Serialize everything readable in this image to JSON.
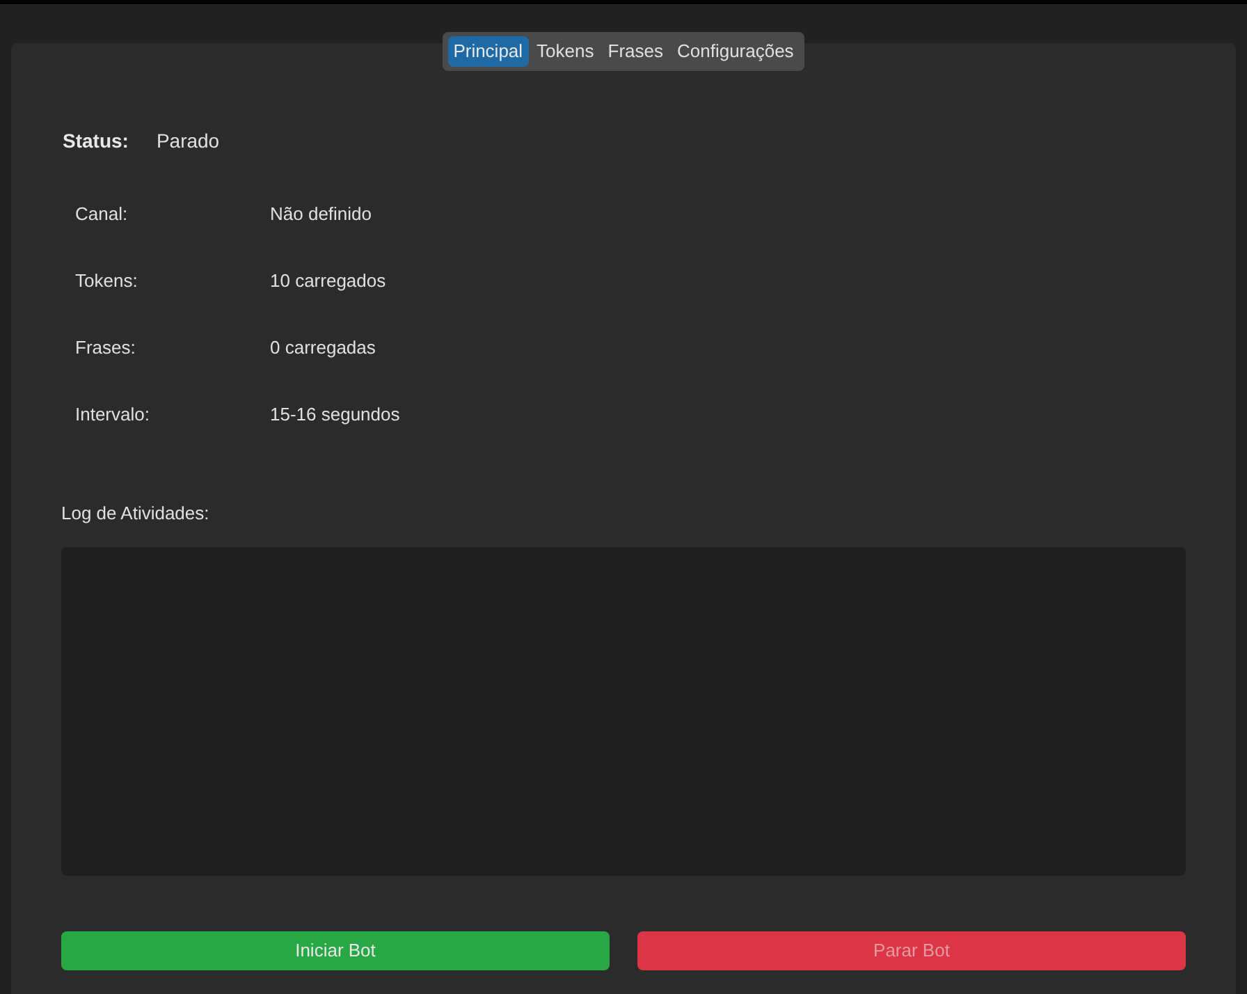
{
  "tabs": [
    {
      "label": "Principal",
      "selected": true
    },
    {
      "label": "Tokens",
      "selected": false
    },
    {
      "label": "Frases",
      "selected": false
    },
    {
      "label": "Configurações",
      "selected": false
    }
  ],
  "status": {
    "label": "Status:",
    "value": "Parado"
  },
  "info": [
    {
      "label": "Canal:",
      "value": "Não definido"
    },
    {
      "label": "Tokens:",
      "value": "10 carregados"
    },
    {
      "label": "Frases:",
      "value": "0 carregadas"
    },
    {
      "label": "Intervalo:",
      "value": "15-16 segundos"
    }
  ],
  "log": {
    "label": "Log de Atividades:"
  },
  "buttons": [
    {
      "label": "Iniciar Bot",
      "kind": "start",
      "disabled": false
    },
    {
      "label": "Parar Bot",
      "kind": "stop",
      "disabled": true
    }
  ]
}
